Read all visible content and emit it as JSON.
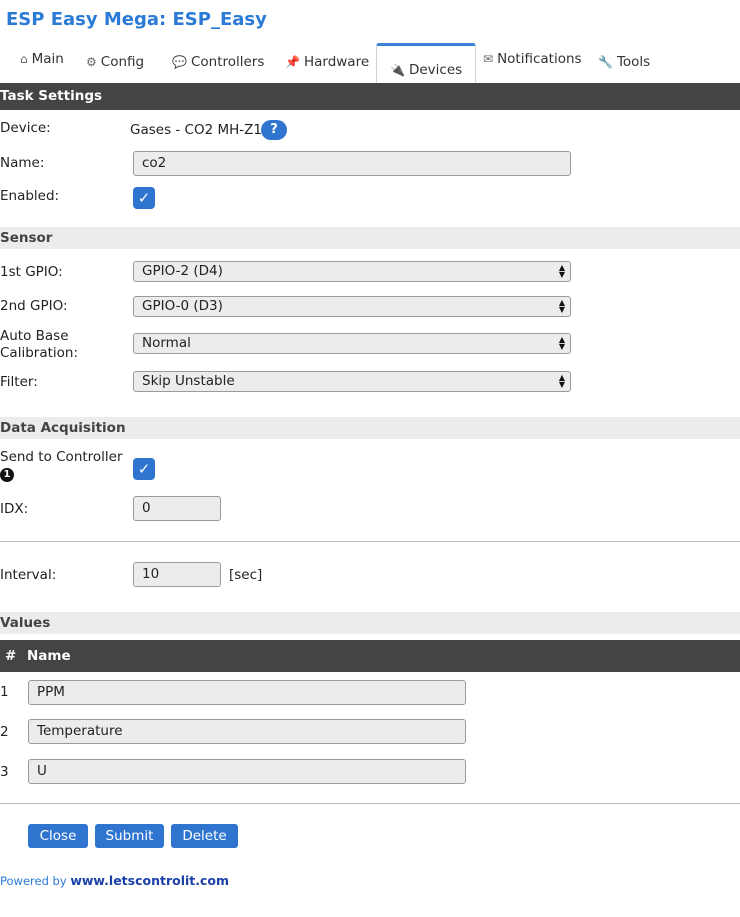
{
  "app": {
    "title": "ESP Easy Mega: ESP_Easy"
  },
  "tabs": [
    {
      "label": "Main",
      "icon": "⌂"
    },
    {
      "label": "Config",
      "icon": "⚙"
    },
    {
      "label": "Controllers",
      "icon": "💬"
    },
    {
      "label": "Hardware",
      "icon": "📌"
    },
    {
      "label": "Devices",
      "icon": "🔌"
    },
    {
      "label": "Notifications",
      "icon": "✉"
    },
    {
      "label": "Tools",
      "icon": "🔧"
    }
  ],
  "task_settings": {
    "header": "Task Settings",
    "device_label": "Device:",
    "device_value": "Gases - CO2 MH-Z19",
    "help": "?",
    "name_label": "Name:",
    "name_value": "co2",
    "enabled_label": "Enabled:",
    "enabled_checked": true
  },
  "sensor": {
    "header": "Sensor",
    "gpio1_label": "1st GPIO:",
    "gpio1_value": "GPIO-2 (D4)",
    "gpio2_label": "2nd GPIO:",
    "gpio2_value": "GPIO-0 (D3)",
    "abc_label_line1": "Auto Base",
    "abc_label_line2": "Calibration:",
    "abc_value": "Normal",
    "filter_label": "Filter:",
    "filter_value": "Skip Unstable"
  },
  "data_acquisition": {
    "header": "Data Acquisition",
    "send_label": "Send to Controller",
    "controller_badge": "1",
    "send_checked": true,
    "idx_label": "IDX:",
    "idx_value": "0",
    "interval_label": "Interval:",
    "interval_value": "10",
    "interval_unit": "[sec]"
  },
  "values": {
    "header": "Values",
    "col_num": "#",
    "col_name": "Name",
    "rows": [
      {
        "num": "1",
        "name": "PPM"
      },
      {
        "num": "2",
        "name": "Temperature"
      },
      {
        "num": "3",
        "name": "U"
      }
    ]
  },
  "actions": {
    "close": "Close",
    "submit": "Submit",
    "delete": "Delete"
  },
  "footer": {
    "prefix": "Powered by",
    "link": "www.letscontrolit.com"
  },
  "colors": {
    "accent": "#2f75d0",
    "title": "#2b7bd6",
    "header_bar": "#444444",
    "section_bar": "#ececec"
  }
}
